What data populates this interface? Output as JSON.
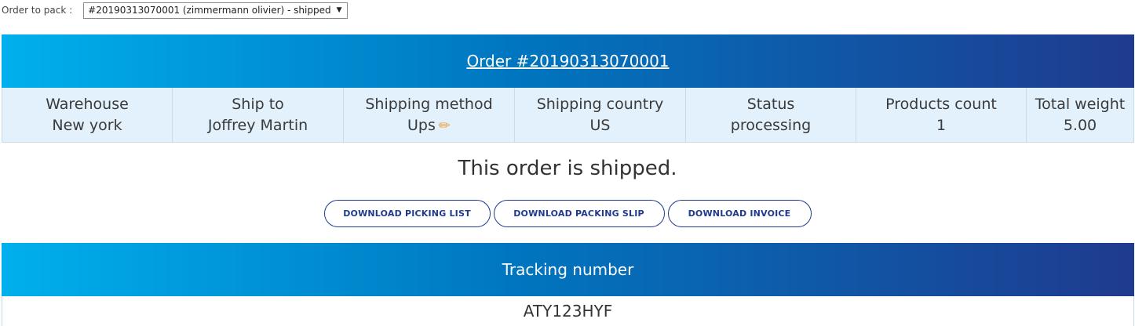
{
  "selector": {
    "label": "Order to pack :",
    "selected": "#20190313070001 (zimmermann olivier) - shipped",
    "arrow_icon": "triangle-down-icon"
  },
  "order": {
    "title": "Order #20190313070001"
  },
  "info": [
    {
      "label": "Warehouse",
      "value": "New york"
    },
    {
      "label": "Ship to",
      "value": "Joffrey Martin"
    },
    {
      "label": "Shipping method",
      "value": "Ups",
      "edit_icon": "pencil-icon"
    },
    {
      "label": "Shipping country",
      "value": "US"
    },
    {
      "label": "Status",
      "value": "processing"
    },
    {
      "label": "Products count",
      "value": "1"
    },
    {
      "label": "Total weight",
      "value": "5.00"
    }
  ],
  "message": "This order is shipped.",
  "buttons": {
    "picking": "DOWNLOAD PICKING LIST",
    "packing": "DOWNLOAD PACKING SLIP",
    "invoice": "DOWNLOAD INVOICE"
  },
  "tracking": {
    "header": "Tracking number",
    "value": "ATY123HYF"
  },
  "colors": {
    "gradient_start": "#00b0ec",
    "gradient_end": "#1f3a8e",
    "info_bg": "#e3f1fd",
    "button_border": "#1f3a8e"
  }
}
